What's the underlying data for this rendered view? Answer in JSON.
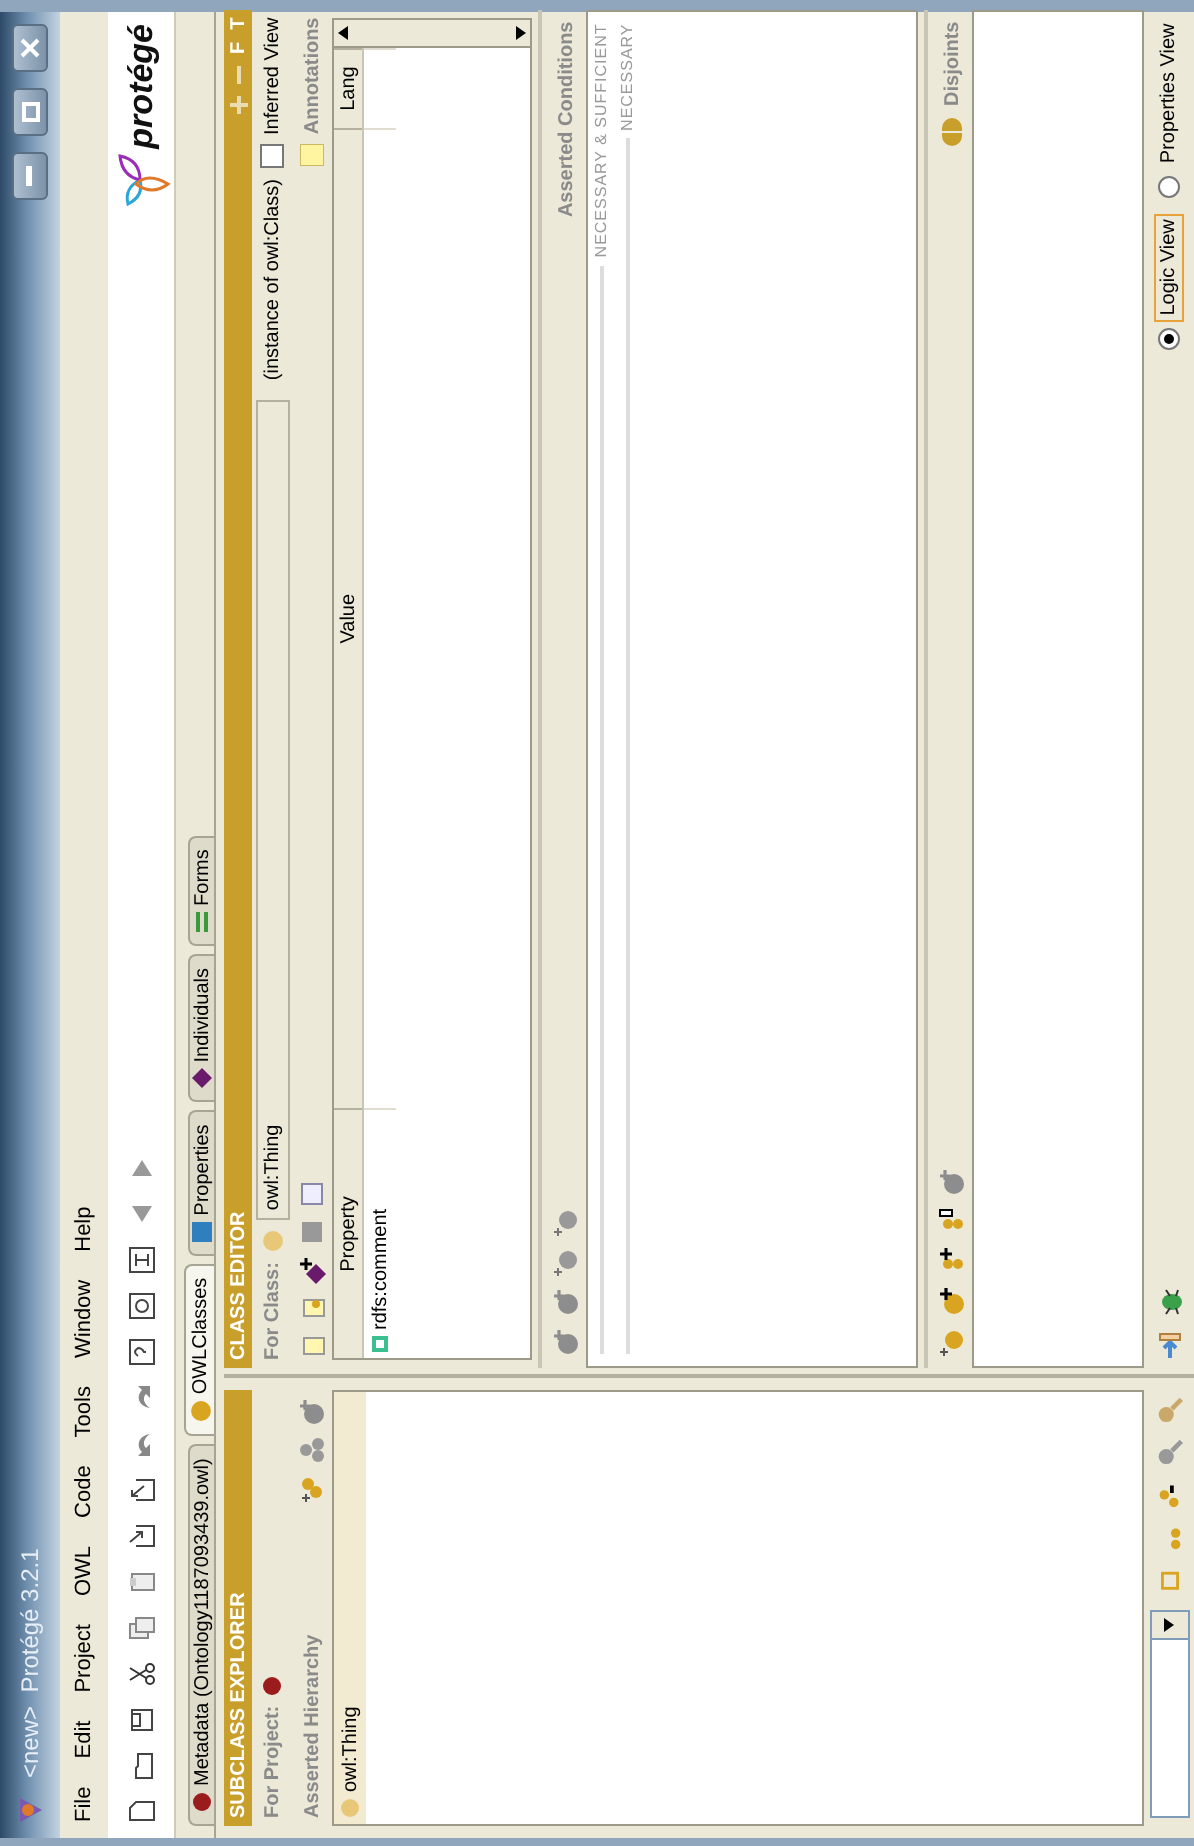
{
  "window": {
    "title": "<new>  Protégé 3.2.1",
    "logo_text": "protégé"
  },
  "menu": [
    "File",
    "Edit",
    "Project",
    "OWL",
    "Code",
    "Tools",
    "Window",
    "Help"
  ],
  "tabs": [
    {
      "label": "Metadata (Ontology1187093439.owl)",
      "selected": false,
      "kind": "metadata"
    },
    {
      "label": "OWLClasses",
      "selected": true,
      "kind": "classes"
    },
    {
      "label": "Properties",
      "selected": false,
      "kind": "properties"
    },
    {
      "label": "Individuals",
      "selected": false,
      "kind": "individuals"
    },
    {
      "label": "Forms",
      "selected": false,
      "kind": "forms"
    }
  ],
  "subclass_explorer": {
    "title": "SUBCLASS EXPLORER",
    "for_project_label": "For Project:",
    "hierarchy_label": "Asserted Hierarchy",
    "tree": [
      {
        "label": "owl:Thing"
      }
    ]
  },
  "class_editor": {
    "title": "CLASS EDITOR",
    "header_buttons": [
      "F",
      "T"
    ],
    "for_class_label": "For Class:",
    "class_field": "owl:Thing",
    "instance_of": "(instance of owl:Class)",
    "inferred_view": {
      "label": "Inferred View",
      "checked": false
    },
    "annotations_label": "Annotations",
    "annotation_table": {
      "columns": [
        "Property",
        "Value",
        "Lang"
      ],
      "rows": [
        {
          "property": "rdfs:comment"
        }
      ]
    }
  },
  "asserted_conditions": {
    "title": "Asserted Conditions",
    "groups": [
      "NECESSARY & SUFFICIENT",
      "NECESSARY"
    ]
  },
  "disjoints": {
    "title": "Disjoints"
  },
  "view_options": [
    {
      "label": "Logic View",
      "selected": true
    },
    {
      "label": "Properties View",
      "selected": false
    }
  ]
}
